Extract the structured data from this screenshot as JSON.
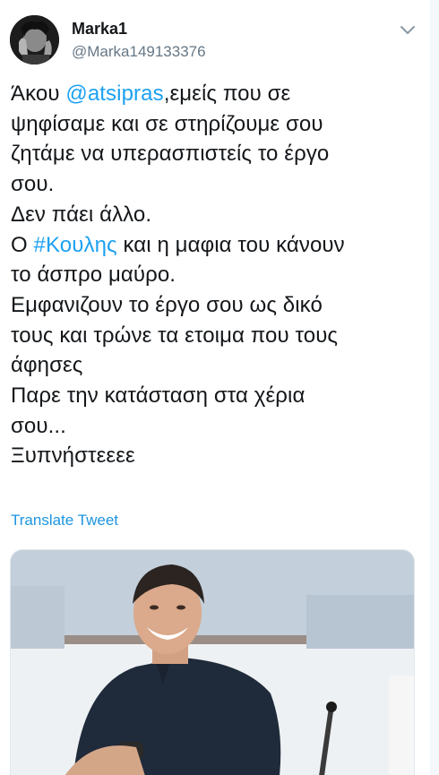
{
  "author": {
    "display_name": "Marka1",
    "handle": "@Marka149133376",
    "avatar_icon": "user-avatar-photo"
  },
  "menu": {
    "icon": "chevron-down-icon"
  },
  "tweet": {
    "lines": [
      {
        "pre": "Άκου ",
        "link": "@atsipras",
        "post": ",εμείς που σε"
      },
      {
        "pre": "ψηφίσαμε και σε στηρίζουμε σου"
      },
      {
        "pre": "ζητάμε να υπερασπιστείς το έργο"
      },
      {
        "pre": "σου."
      },
      {
        "pre": "Δεν πάει άλλο."
      },
      {
        "pre": "Ο ",
        "link": "#Κουλης",
        "post": " και η μαφια του κάνουν"
      },
      {
        "pre": "το άσπρο μαύρο."
      },
      {
        "pre": "Εμφανιζουν το έργο σου ως δικό"
      },
      {
        "pre": "τους και τρώνε τα ετοιμα που τους"
      },
      {
        "pre": "άφησες"
      },
      {
        "pre": "Παρε την κατάσταση στα χέρια"
      },
      {
        "pre": "σου..."
      },
      {
        "pre": "Ξυπνήστεεεε"
      }
    ]
  },
  "translate_label": "Translate Tweet",
  "media": {
    "kind": "photo",
    "description_icon": "tweet-photo"
  },
  "colors": {
    "link": "#1da1f2",
    "text": "#14171a",
    "secondary": "#657786"
  }
}
